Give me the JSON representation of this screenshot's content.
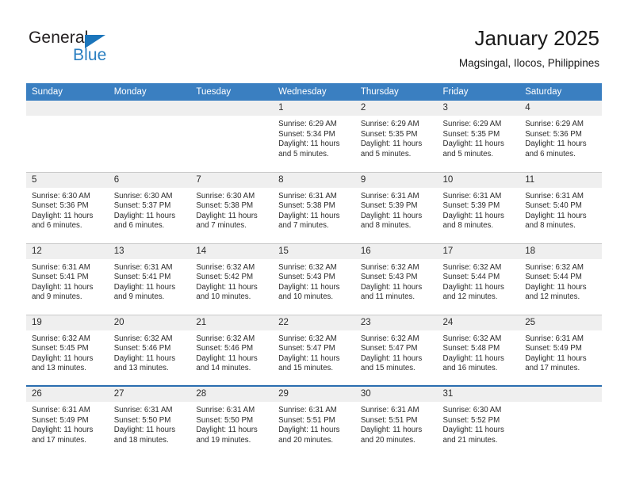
{
  "branding": {
    "logo_text_primary": "General",
    "logo_text_secondary": "Blue",
    "triangle_icon": "triangle-icon",
    "primary_color": "#2a7fc1",
    "header_color": "#3a7fc1"
  },
  "header": {
    "title": "January 2025",
    "subtitle": "Magsingal, Ilocos, Philippines"
  },
  "weekday_headers": [
    "Sunday",
    "Monday",
    "Tuesday",
    "Wednesday",
    "Thursday",
    "Friday",
    "Saturday"
  ],
  "labels": {
    "sunrise": "Sunrise:",
    "sunset": "Sunset:",
    "daylight": "Daylight:"
  },
  "weeks": [
    [
      {
        "day": "",
        "sunrise": "",
        "sunset": "",
        "daylight_line1": "",
        "daylight_line2": ""
      },
      {
        "day": "",
        "sunrise": "",
        "sunset": "",
        "daylight_line1": "",
        "daylight_line2": ""
      },
      {
        "day": "",
        "sunrise": "",
        "sunset": "",
        "daylight_line1": "",
        "daylight_line2": ""
      },
      {
        "day": "1",
        "sunrise": "Sunrise: 6:29 AM",
        "sunset": "Sunset: 5:34 PM",
        "daylight_line1": "Daylight: 11 hours",
        "daylight_line2": "and 5 minutes."
      },
      {
        "day": "2",
        "sunrise": "Sunrise: 6:29 AM",
        "sunset": "Sunset: 5:35 PM",
        "daylight_line1": "Daylight: 11 hours",
        "daylight_line2": "and 5 minutes."
      },
      {
        "day": "3",
        "sunrise": "Sunrise: 6:29 AM",
        "sunset": "Sunset: 5:35 PM",
        "daylight_line1": "Daylight: 11 hours",
        "daylight_line2": "and 5 minutes."
      },
      {
        "day": "4",
        "sunrise": "Sunrise: 6:29 AM",
        "sunset": "Sunset: 5:36 PM",
        "daylight_line1": "Daylight: 11 hours",
        "daylight_line2": "and 6 minutes."
      }
    ],
    [
      {
        "day": "5",
        "sunrise": "Sunrise: 6:30 AM",
        "sunset": "Sunset: 5:36 PM",
        "daylight_line1": "Daylight: 11 hours",
        "daylight_line2": "and 6 minutes."
      },
      {
        "day": "6",
        "sunrise": "Sunrise: 6:30 AM",
        "sunset": "Sunset: 5:37 PM",
        "daylight_line1": "Daylight: 11 hours",
        "daylight_line2": "and 6 minutes."
      },
      {
        "day": "7",
        "sunrise": "Sunrise: 6:30 AM",
        "sunset": "Sunset: 5:38 PM",
        "daylight_line1": "Daylight: 11 hours",
        "daylight_line2": "and 7 minutes."
      },
      {
        "day": "8",
        "sunrise": "Sunrise: 6:31 AM",
        "sunset": "Sunset: 5:38 PM",
        "daylight_line1": "Daylight: 11 hours",
        "daylight_line2": "and 7 minutes."
      },
      {
        "day": "9",
        "sunrise": "Sunrise: 6:31 AM",
        "sunset": "Sunset: 5:39 PM",
        "daylight_line1": "Daylight: 11 hours",
        "daylight_line2": "and 8 minutes."
      },
      {
        "day": "10",
        "sunrise": "Sunrise: 6:31 AM",
        "sunset": "Sunset: 5:39 PM",
        "daylight_line1": "Daylight: 11 hours",
        "daylight_line2": "and 8 minutes."
      },
      {
        "day": "11",
        "sunrise": "Sunrise: 6:31 AM",
        "sunset": "Sunset: 5:40 PM",
        "daylight_line1": "Daylight: 11 hours",
        "daylight_line2": "and 8 minutes."
      }
    ],
    [
      {
        "day": "12",
        "sunrise": "Sunrise: 6:31 AM",
        "sunset": "Sunset: 5:41 PM",
        "daylight_line1": "Daylight: 11 hours",
        "daylight_line2": "and 9 minutes."
      },
      {
        "day": "13",
        "sunrise": "Sunrise: 6:31 AM",
        "sunset": "Sunset: 5:41 PM",
        "daylight_line1": "Daylight: 11 hours",
        "daylight_line2": "and 9 minutes."
      },
      {
        "day": "14",
        "sunrise": "Sunrise: 6:32 AM",
        "sunset": "Sunset: 5:42 PM",
        "daylight_line1": "Daylight: 11 hours",
        "daylight_line2": "and 10 minutes."
      },
      {
        "day": "15",
        "sunrise": "Sunrise: 6:32 AM",
        "sunset": "Sunset: 5:43 PM",
        "daylight_line1": "Daylight: 11 hours",
        "daylight_line2": "and 10 minutes."
      },
      {
        "day": "16",
        "sunrise": "Sunrise: 6:32 AM",
        "sunset": "Sunset: 5:43 PM",
        "daylight_line1": "Daylight: 11 hours",
        "daylight_line2": "and 11 minutes."
      },
      {
        "day": "17",
        "sunrise": "Sunrise: 6:32 AM",
        "sunset": "Sunset: 5:44 PM",
        "daylight_line1": "Daylight: 11 hours",
        "daylight_line2": "and 12 minutes."
      },
      {
        "day": "18",
        "sunrise": "Sunrise: 6:32 AM",
        "sunset": "Sunset: 5:44 PM",
        "daylight_line1": "Daylight: 11 hours",
        "daylight_line2": "and 12 minutes."
      }
    ],
    [
      {
        "day": "19",
        "sunrise": "Sunrise: 6:32 AM",
        "sunset": "Sunset: 5:45 PM",
        "daylight_line1": "Daylight: 11 hours",
        "daylight_line2": "and 13 minutes."
      },
      {
        "day": "20",
        "sunrise": "Sunrise: 6:32 AM",
        "sunset": "Sunset: 5:46 PM",
        "daylight_line1": "Daylight: 11 hours",
        "daylight_line2": "and 13 minutes."
      },
      {
        "day": "21",
        "sunrise": "Sunrise: 6:32 AM",
        "sunset": "Sunset: 5:46 PM",
        "daylight_line1": "Daylight: 11 hours",
        "daylight_line2": "and 14 minutes."
      },
      {
        "day": "22",
        "sunrise": "Sunrise: 6:32 AM",
        "sunset": "Sunset: 5:47 PM",
        "daylight_line1": "Daylight: 11 hours",
        "daylight_line2": "and 15 minutes."
      },
      {
        "day": "23",
        "sunrise": "Sunrise: 6:32 AM",
        "sunset": "Sunset: 5:47 PM",
        "daylight_line1": "Daylight: 11 hours",
        "daylight_line2": "and 15 minutes."
      },
      {
        "day": "24",
        "sunrise": "Sunrise: 6:32 AM",
        "sunset": "Sunset: 5:48 PM",
        "daylight_line1": "Daylight: 11 hours",
        "daylight_line2": "and 16 minutes."
      },
      {
        "day": "25",
        "sunrise": "Sunrise: 6:31 AM",
        "sunset": "Sunset: 5:49 PM",
        "daylight_line1": "Daylight: 11 hours",
        "daylight_line2": "and 17 minutes."
      }
    ],
    [
      {
        "day": "26",
        "sunrise": "Sunrise: 6:31 AM",
        "sunset": "Sunset: 5:49 PM",
        "daylight_line1": "Daylight: 11 hours",
        "daylight_line2": "and 17 minutes."
      },
      {
        "day": "27",
        "sunrise": "Sunrise: 6:31 AM",
        "sunset": "Sunset: 5:50 PM",
        "daylight_line1": "Daylight: 11 hours",
        "daylight_line2": "and 18 minutes."
      },
      {
        "day": "28",
        "sunrise": "Sunrise: 6:31 AM",
        "sunset": "Sunset: 5:50 PM",
        "daylight_line1": "Daylight: 11 hours",
        "daylight_line2": "and 19 minutes."
      },
      {
        "day": "29",
        "sunrise": "Sunrise: 6:31 AM",
        "sunset": "Sunset: 5:51 PM",
        "daylight_line1": "Daylight: 11 hours",
        "daylight_line2": "and 20 minutes."
      },
      {
        "day": "30",
        "sunrise": "Sunrise: 6:31 AM",
        "sunset": "Sunset: 5:51 PM",
        "daylight_line1": "Daylight: 11 hours",
        "daylight_line2": "and 20 minutes."
      },
      {
        "day": "31",
        "sunrise": "Sunrise: 6:30 AM",
        "sunset": "Sunset: 5:52 PM",
        "daylight_line1": "Daylight: 11 hours",
        "daylight_line2": "and 21 minutes."
      },
      {
        "day": "",
        "sunrise": "",
        "sunset": "",
        "daylight_line1": "",
        "daylight_line2": ""
      }
    ]
  ]
}
